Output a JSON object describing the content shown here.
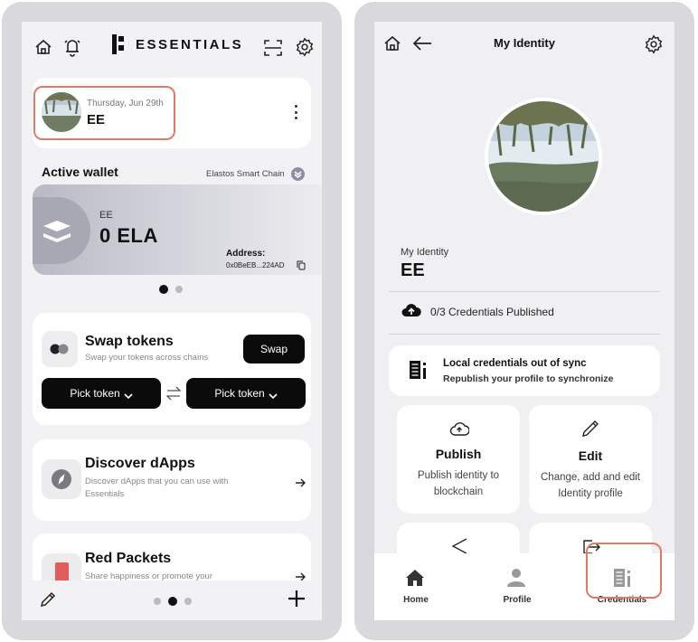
{
  "left_screen": {
    "header": {
      "logo_text": "ESSENTIALS",
      "icons": [
        "home-icon",
        "bell-icon",
        "scan-icon",
        "gear-icon"
      ]
    },
    "profile": {
      "date": "Thursday, Jun 29th",
      "name": "EE"
    },
    "wallet": {
      "section_title": "Active wallet",
      "network": "Elastos Smart Chain",
      "wallet_name": "EE",
      "balance": "0 ELA",
      "address_label": "Address:",
      "address": "0x0BeEB...224AD"
    },
    "swap": {
      "title": "Swap tokens",
      "subtitle": "Swap your tokens across chains",
      "swap_button": "Swap",
      "pick_token_1": "Pick token",
      "pick_token_2": "Pick token"
    },
    "discover": {
      "title": "Discover dApps",
      "subtitle": "Discover dApps that you can use with Essentials"
    },
    "red_packets": {
      "title": "Red Packets",
      "subtitle": "Share happiness or promote your"
    }
  },
  "right_screen": {
    "header": {
      "title": "My Identity"
    },
    "identity": {
      "label": "My Identity",
      "name": "EE"
    },
    "credentials_status": "0/3 Credentials Published",
    "sync_notice": {
      "title": "Local credentials out of sync",
      "subtitle": "Republish your profile to synchronize"
    },
    "actions": [
      {
        "title": "Publish",
        "description": "Publish identity to blockchain"
      },
      {
        "title": "Edit",
        "description": "Change, add and edit Identity profile"
      }
    ],
    "tabs": [
      {
        "label": "Home"
      },
      {
        "label": "Profile"
      },
      {
        "label": "Credentials"
      }
    ]
  },
  "colors": {
    "highlight": "#e07a68",
    "accent": "#0b0b0b",
    "background": "#f2f2f4"
  }
}
